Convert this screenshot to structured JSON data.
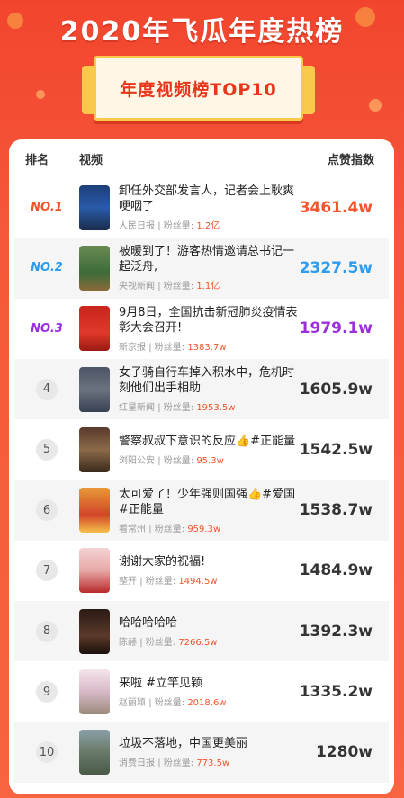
{
  "banner": {
    "title": "2020年飞瓜年度热榜",
    "subtitle": "年度视频榜TOP10"
  },
  "table": {
    "headers": {
      "rank": "排名",
      "video": "视频",
      "likes": "点赞指数"
    },
    "fans_label": "粉丝量:",
    "rows": [
      {
        "rank": "NO.1",
        "title": "卸任外交部发言人，记者会上耿爽哽咽了",
        "author": "人民日报",
        "fans": "1.2亿",
        "likes": "3461.4w",
        "rank_color": "#f2552c",
        "likes_color": "#f2552c"
      },
      {
        "rank": "NO.2",
        "title": "被暖到了！游客热情邀请总书记一起泛舟,",
        "author": "央视新闻",
        "fans": "1.1亿",
        "likes": "2327.5w",
        "rank_color": "#2d9cf0",
        "likes_color": "#2d9cf0"
      },
      {
        "rank": "NO.3",
        "title": "9月8日，全国抗击新冠肺炎疫情表彰大会召开!",
        "author": "新京报",
        "fans": "1383.7w",
        "likes": "1979.1w",
        "rank_color": "#9b2fe0",
        "likes_color": "#9b2fe0"
      },
      {
        "rank": "4",
        "title": "女子骑自行车掉入积水中，危机时刻他们出手相助",
        "author": "红星新闻",
        "fans": "1953.5w",
        "likes": "1605.9w"
      },
      {
        "rank": "5",
        "title": "警察叔叔下意识的反应👍#正能量",
        "author": "浏阳公安",
        "fans": "95.3w",
        "likes": "1542.5w"
      },
      {
        "rank": "6",
        "title": "太可爱了！少年强则国强👍#爱国 #正能量",
        "author": "看常州",
        "fans": "959.3w",
        "likes": "1538.7w"
      },
      {
        "rank": "7",
        "title": "谢谢大家的祝福!",
        "author": "整开",
        "fans": "1494.5w",
        "likes": "1484.9w"
      },
      {
        "rank": "8",
        "title": "哈哈哈哈哈",
        "author": "陈赫",
        "fans": "7266.5w",
        "likes": "1392.3w"
      },
      {
        "rank": "9",
        "title": "来啦 #立竿见颖",
        "author": "赵丽颖",
        "fans": "2018.6w",
        "likes": "1335.2w"
      },
      {
        "rank": "10",
        "title": "垃圾不落地，中国更美丽",
        "author": "消费日报",
        "fans": "773.5w",
        "likes": "1280w"
      }
    ]
  },
  "colors": {
    "brand_red": "#f2452e",
    "gold": "#f8c94a",
    "fans_orange": "#f2552c"
  }
}
